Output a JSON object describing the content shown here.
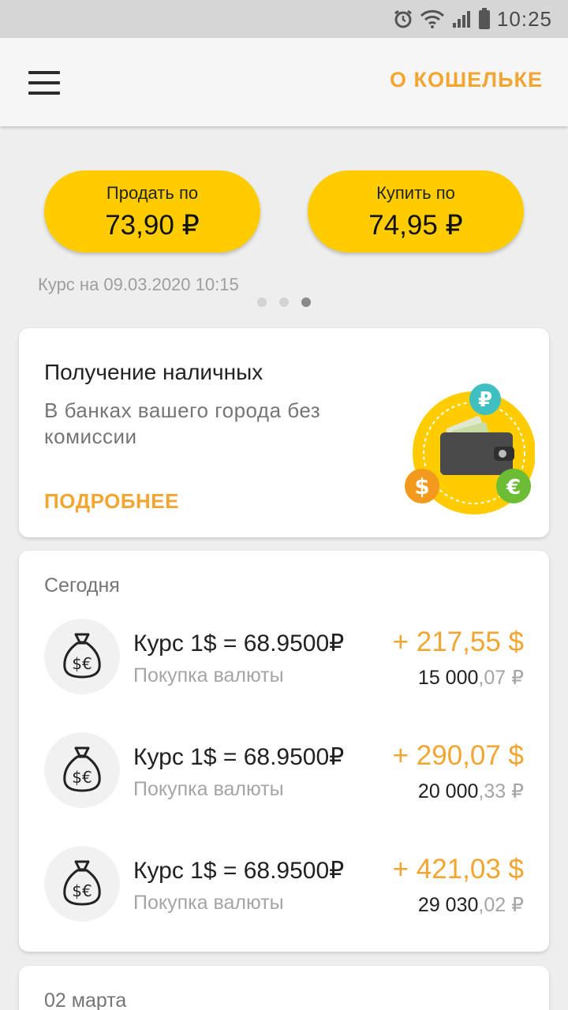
{
  "status_bar": {
    "time": "10:25",
    "icons": [
      "alarm-icon",
      "wifi-icon",
      "signal-icon",
      "battery-icon"
    ]
  },
  "app_bar": {
    "menu_icon": "hamburger-menu-icon",
    "wallet_link": "О КОШЕЛЬКЕ"
  },
  "rates": {
    "sell": {
      "label": "Продать по",
      "value": "73,90 ₽"
    },
    "buy": {
      "label": "Купить по",
      "value": "74,95 ₽"
    },
    "date": "Курс на 09.03.2020 10:15",
    "pager": {
      "pages": 3,
      "active": 3
    }
  },
  "promo": {
    "title": "Получение наличных",
    "text": "В банках вашего города без комиссии",
    "more": "ПОДРОБНЕЕ",
    "illustration": "wallet-currency-icon"
  },
  "sections": [
    {
      "title": "Сегодня",
      "transactions": [
        {
          "title": "Курс 1$ = 68.9500₽",
          "subtitle": "Покупка валюты",
          "amount": "+ 217,55 $",
          "balance_int": "15 000",
          "balance_dec": ",07 ₽",
          "icon": "money-bag-icon"
        },
        {
          "title": "Курс 1$ = 68.9500₽",
          "subtitle": "Покупка валюты",
          "amount": "+ 290,07 $",
          "balance_int": "20 000",
          "balance_dec": ",33 ₽",
          "icon": "money-bag-icon"
        },
        {
          "title": "Курс 1$ = 68.9500₽",
          "subtitle": "Покупка валюты",
          "amount": "+ 421,03 $",
          "balance_int": "29 030",
          "balance_dec": ",02 ₽",
          "icon": "money-bag-icon"
        }
      ]
    },
    {
      "title": "02 марта"
    }
  ],
  "colors": {
    "accent": "#f2a531",
    "pill": "#ffcc00",
    "background": "#eeeeee"
  }
}
